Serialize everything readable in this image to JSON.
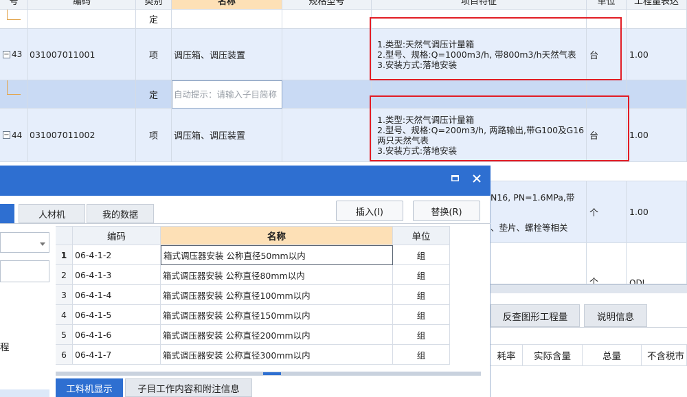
{
  "header": {
    "cols": [
      "号",
      "编码",
      "类别",
      "名称",
      "规格型号",
      "项目特征",
      "单位",
      "工程量表达"
    ]
  },
  "rows": [
    {
      "num": "",
      "code": "",
      "cat": "定",
      "name": "",
      "feature": "",
      "unit": "",
      "qty": ""
    },
    {
      "num": "43",
      "code": "031007011001",
      "cat": "项",
      "name": "调压箱、调压装置",
      "feature_lines": [
        "1.类型:天然气调压计量箱",
        "2.型号、规格:Q=1000m3/h, 带800m3/h天然气表",
        "3.安装方式:落地安装"
      ],
      "unit": "台",
      "qty": "1.00"
    },
    {
      "num": "",
      "code": "",
      "cat": "定",
      "name": "自动提示：请输入子目简称",
      "unit": "",
      "qty": ""
    },
    {
      "num": "44",
      "code": "031007011002",
      "cat": "项",
      "name": "调压箱、调压装置",
      "feature_lines": [
        "1.类型:天然气调压计量箱",
        "2.型号、规格:Q=200m3/h, 两路输出,带G100及G16两只天然气表",
        "3.安装方式:落地安装"
      ],
      "unit": "台",
      "qty": "1.00"
    }
  ],
  "partial_rows": {
    "row45_feature_a": "N16, PN=1.6MPa,带",
    "row45_feature_b": "、垫片、螺栓等相关",
    "row45_unit": "个",
    "row45_qty": "1.00",
    "row46_unit": "个",
    "row46_qty": "ODL"
  },
  "dialog": {
    "controls": {
      "restore": "□",
      "close": "✕"
    },
    "tabs": [
      "人材机",
      "我的数据"
    ],
    "buttons": {
      "insert": "插入(I)",
      "replace": "替换(R)"
    },
    "left_labels": {
      "item": "程"
    },
    "grid_headers": {
      "code": "编码",
      "name": "名称",
      "unit": "单位"
    },
    "grid_rows": [
      {
        "n": "1",
        "code": "06-4-1-2",
        "name": "箱式调压器安装 公称直径50mm以内",
        "unit": "组"
      },
      {
        "n": "2",
        "code": "06-4-1-3",
        "name": "箱式调压器安装 公称直径80mm以内",
        "unit": "组"
      },
      {
        "n": "3",
        "code": "06-4-1-4",
        "name": "箱式调压器安装 公称直径100mm以内",
        "unit": "组"
      },
      {
        "n": "4",
        "code": "06-4-1-5",
        "name": "箱式调压器安装 公称直径150mm以内",
        "unit": "组"
      },
      {
        "n": "5",
        "code": "06-4-1-6",
        "name": "箱式调压器安装 公称直径200mm以内",
        "unit": "组"
      },
      {
        "n": "6",
        "code": "06-4-1-7",
        "name": "箱式调压器安装 公称直径300mm以内",
        "unit": "组"
      }
    ],
    "bottom_tabs": [
      "工料机显示",
      "子目工作内容和附注信息"
    ]
  },
  "right_panel": {
    "tabs": [
      "反查图形工程量",
      "说明信息"
    ],
    "cols": [
      "耗率",
      "实际含量",
      "总量",
      "不含税市"
    ]
  },
  "colors": {
    "accent": "#2e6fd1",
    "highlight": "#e21c24",
    "row_blue": "#e6eefb"
  }
}
